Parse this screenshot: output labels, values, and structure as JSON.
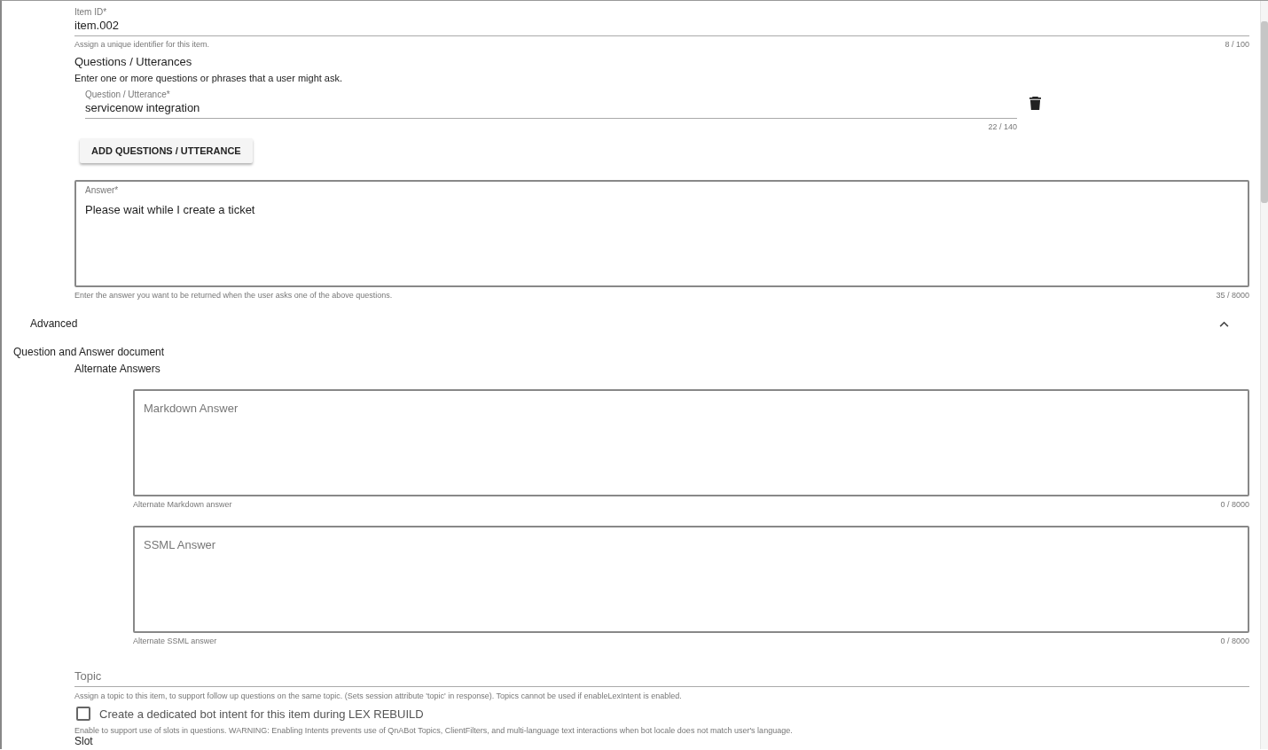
{
  "item_id": {
    "label": "Item ID*",
    "value": "item.002",
    "hint": "Assign a unique identifier for this item.",
    "counter": "8 / 100"
  },
  "questions": {
    "title": "Questions / Utterances",
    "description": "Enter one or more questions or phrases that a user might ask.",
    "items": [
      {
        "label": "Question / Utterance*",
        "value": "servicenow integration",
        "counter": "22 / 140"
      }
    ],
    "add_button": "ADD QUESTIONS / UTTERANCE"
  },
  "answer": {
    "label": "Answer*",
    "value": "Please wait while I create a ticket",
    "hint": "Enter the answer you want to be returned when the user asks one of the above questions.",
    "counter": "35 / 8000"
  },
  "advanced": {
    "title": "Advanced",
    "expanded": true
  },
  "document_title": "Question and Answer document",
  "alternate": {
    "title": "Alternate Answers",
    "fields": [
      {
        "placeholder": "Markdown Answer",
        "hint": "Alternate Markdown answer",
        "counter": "0 / 8000"
      },
      {
        "placeholder": "SSML Answer",
        "hint": "Alternate SSML answer",
        "counter": "0 / 8000"
      }
    ]
  },
  "topic": {
    "placeholder": "Topic",
    "hint": "Assign a topic to this item, to support follow up questions on the same topic. (Sets session attribute 'topic' in response). Topics cannot be used if enableLexIntent is enabled."
  },
  "lex_intent": {
    "label": "Create a dedicated bot intent for this item during LEX REBUILD",
    "checked": false,
    "hint": "Enable to support use of slots in questions. WARNING: Enabling Intents prevents use of QnABot Topics, ClientFilters, and multi-language text interactions when bot locale does not match user's language."
  },
  "next_section": "Slot"
}
